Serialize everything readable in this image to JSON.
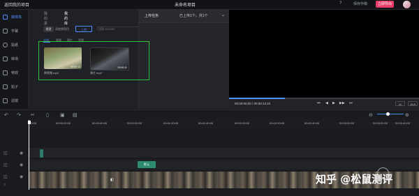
{
  "topbar": {
    "back": "返回我的项目",
    "title": "未命名项目",
    "help": "帮助",
    "sync": "保存作稿",
    "export": "立即导出"
  },
  "nav": [
    {
      "label": "媒体库",
      "icon": "media-icon"
    },
    {
      "label": "字幕",
      "icon": "subtitle-icon"
    },
    {
      "label": "贴纸",
      "icon": "sticker-icon"
    },
    {
      "label": "转场",
      "icon": "transition-icon"
    },
    {
      "label": "特效",
      "icon": "effect-icon"
    },
    {
      "label": "贴子",
      "icon": "post-icon"
    },
    {
      "label": "滤镜",
      "icon": "filter-icon"
    }
  ],
  "media": {
    "tabs": [
      "我的素材",
      "我的库"
    ],
    "type_btn": "类型",
    "add_btn": "添加到项目",
    "upload_btn": "上传",
    "storage": "已用0.1G/10G",
    "search_placeholder": "搜索",
    "subtabs": [
      "全部",
      "视频",
      "图片",
      "音频"
    ],
    "clips": [
      {
        "name": "原视频.mp4",
        "duration": "00:00:13"
      },
      {
        "name": "原片.mp4",
        "duration": "00:00:11"
      }
    ]
  },
  "upload_panel": {
    "title": "上传任务",
    "status": "已上传1个，共1个"
  },
  "preview": {
    "time": "00:00:00:00 / 00:00:13:22",
    "speed": "1x",
    "ratio": "16:9"
  },
  "timeline": {
    "ticks": [
      "00:00",
      "00:00:20:00",
      "00:00:40:00",
      "00:01:00:00",
      "00:01:20:00",
      "00:01:40:00",
      "00:02:00:00",
      "00:02:20:00",
      "00:02:40:00",
      "00:03:00:00",
      "00:03:20:00",
      "00:03:40:00"
    ],
    "text_clip": "默认"
  },
  "watermark": "知乎 @松鼠测评"
}
